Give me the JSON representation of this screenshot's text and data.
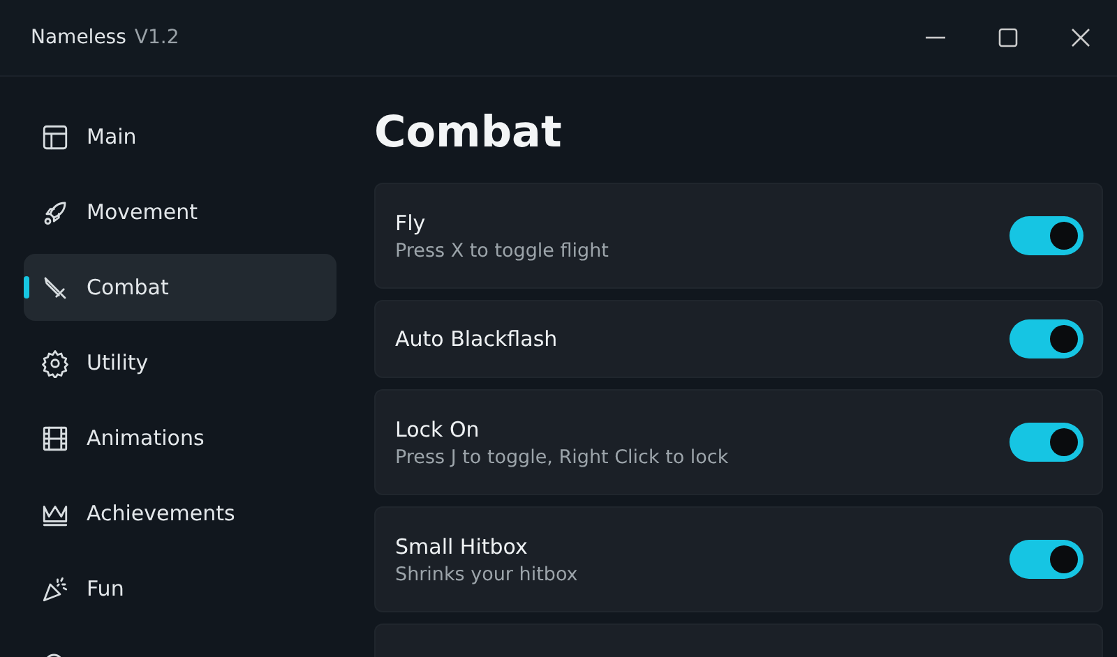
{
  "window": {
    "title": "Nameless",
    "version": "V1.2"
  },
  "sidebar": {
    "items": [
      {
        "label": "Main",
        "selected": false
      },
      {
        "label": "Movement",
        "selected": false
      },
      {
        "label": "Combat",
        "selected": true
      },
      {
        "label": "Utility",
        "selected": false
      },
      {
        "label": "Animations",
        "selected": false
      },
      {
        "label": "Achievements",
        "selected": false
      },
      {
        "label": "Fun",
        "selected": false
      },
      {
        "selected": false
      }
    ]
  },
  "content": {
    "heading": "Combat",
    "options": [
      {
        "name": "Fly",
        "description": "Press X to toggle flight",
        "on": true
      },
      {
        "name": "Auto Blackflash",
        "on": true
      },
      {
        "name": "Lock On",
        "description": "Press J to toggle, Right Click to lock",
        "on": true
      },
      {
        "name": "Small Hitbox",
        "description": "Shrinks your hitbox",
        "on": true
      }
    ]
  }
}
